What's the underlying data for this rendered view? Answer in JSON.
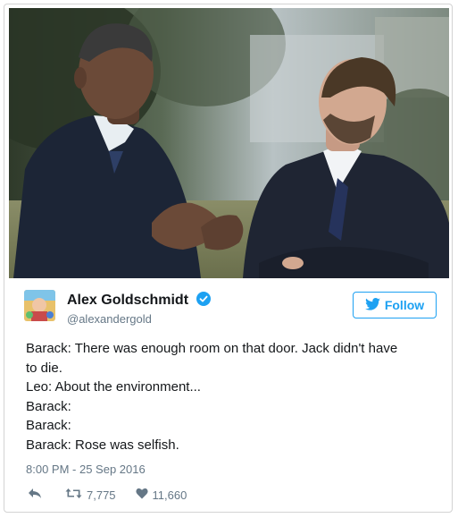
{
  "user": {
    "display_name": "Alex Goldschmidt",
    "handle": "@alexandergold"
  },
  "follow": {
    "label": "Follow"
  },
  "tweet": {
    "lines": [
      "Barack: There was enough room on that door. Jack didn't have",
      "to die.",
      "Leo: About the environment...",
      "Barack:",
      "Barack:",
      "Barack: Rose was selfish."
    ],
    "timestamp": "8:00 PM - 25 Sep 2016"
  },
  "actions": {
    "retweets": "7,775",
    "likes": "11,660"
  },
  "icons": {
    "verified": "verified-badge-icon",
    "bird": "twitter-bird-icon",
    "reply": "reply-icon",
    "retweet": "retweet-icon",
    "like": "heart-icon"
  },
  "colors": {
    "brand_blue": "#1da1f2",
    "text": "#14171a",
    "secondary_text": "#657786"
  }
}
